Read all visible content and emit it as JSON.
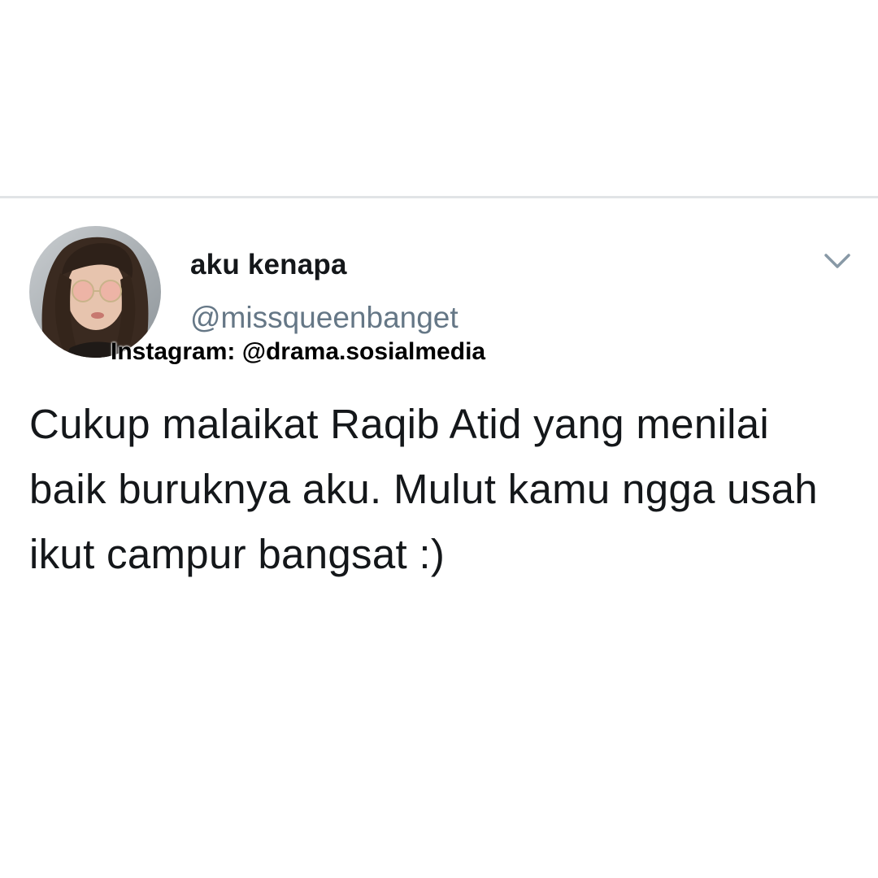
{
  "tweet": {
    "author": {
      "display_name": "aku kenapa",
      "handle": "@missqueenbanget"
    },
    "watermark": "Instagram: @drama.sosialmedia",
    "text": "Cukup malaikat Raqib Atid yang menilai baik buruknya aku. Mulut kamu ngga usah ikut campur bangsat :)",
    "menu_icon": "chevron-down-icon"
  },
  "colors": {
    "text_primary": "#14171a",
    "text_secondary": "#657786",
    "divider": "#e1e4e6",
    "icon": "#8899a6"
  }
}
